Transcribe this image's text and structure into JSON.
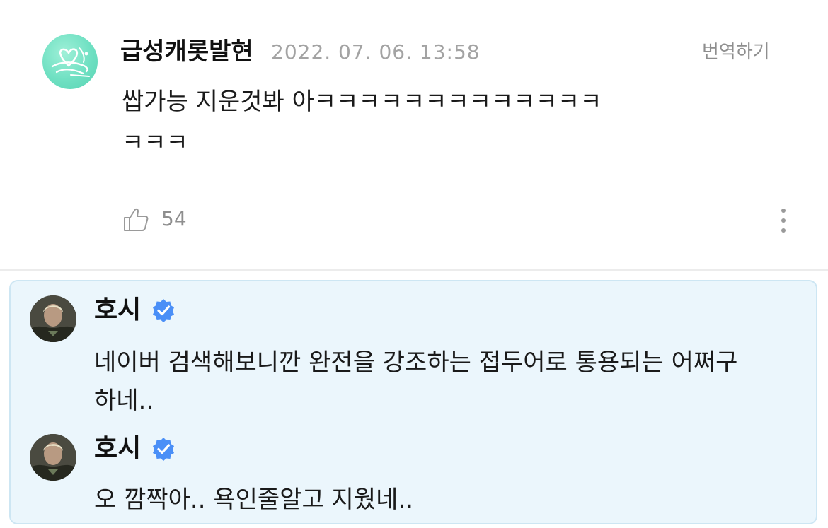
{
  "comment": {
    "author": "급성캐롯발현",
    "date": "2022. 07. 06. 13:58",
    "translate_label": "번역하기",
    "text_line1": "쌉가능 지운것봐 아ㅋㅋㅋㅋㅋㅋㅋㅋㅋㅋㅋㅋㅋ",
    "text_line2": "ㅋㅋㅋ",
    "like_count": "54",
    "avatar_icon": "heart-signature-avatar",
    "like_icon": "thumbs-up-icon",
    "more_icon": "more-vertical-icon"
  },
  "replies": [
    {
      "author": "호시",
      "verified_icon": "verified-badge-icon",
      "text_line1": "네이버 검색해보니깐 완전을 강조하는 접두어로 통용되는 어쩌구",
      "text_line2": "하네.."
    },
    {
      "author": "호시",
      "verified_icon": "verified-badge-icon",
      "text_line1": "오 깜짝아.. 욕인줄알고 지웠네.."
    }
  ],
  "colors": {
    "reply_background": "#ebf6fc",
    "verified_blue": "#4a8ff7",
    "avatar_mint": "#6fe0c2"
  }
}
